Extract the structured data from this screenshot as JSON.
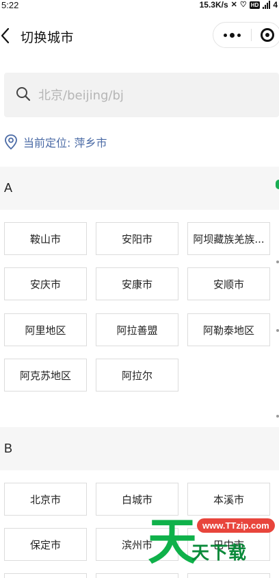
{
  "status_bar": {
    "time": "5:22",
    "net_speed": "15.3K/s",
    "hd_badge": "HD",
    "battery_partial": "4"
  },
  "nav": {
    "title": "切换城市"
  },
  "search": {
    "placeholder": "北京/beijing/bj",
    "value": ""
  },
  "location": {
    "label": "当前定位: 萍乡市"
  },
  "sections": [
    {
      "letter": "A",
      "cities": [
        "鞍山市",
        "安阳市",
        "阿坝藏族羌族...",
        "安庆市",
        "安康市",
        "安顺市",
        "阿里地区",
        "阿拉善盟",
        "阿勒泰地区",
        "阿克苏地区",
        "阿拉尔"
      ]
    },
    {
      "letter": "B",
      "cities": [
        "北京市",
        "白城市",
        "本溪市",
        "保定市",
        "滨州市",
        "巴中市"
      ]
    }
  ],
  "watermark": {
    "big": "天",
    "url": "www.TTzip.com",
    "sub": "天下载"
  },
  "colors": {
    "accent_link": "#4a6aa5",
    "green": "#1aad53",
    "section_bg": "#f6f6f6",
    "search_bg": "#f2f2f2"
  }
}
